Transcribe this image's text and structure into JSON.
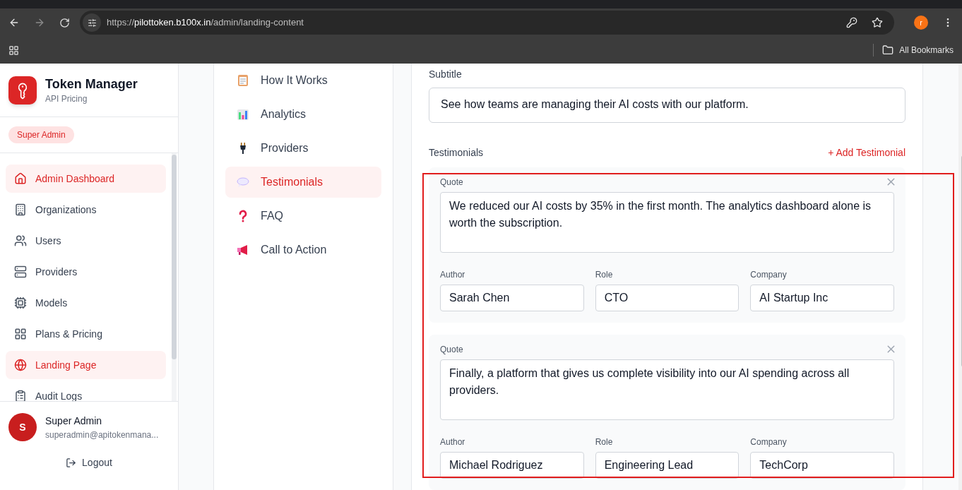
{
  "browser": {
    "url_scheme": "https://",
    "url_host": "pilottoken.b100x.in",
    "url_path": "/admin/landing-content",
    "profile_initial": "r",
    "bookmarks_label": "All Bookmarks"
  },
  "sidebar": {
    "brand_title": "Token Manager",
    "brand_subtitle": "API Pricing",
    "role_badge": "Super Admin",
    "items": [
      {
        "label": "Admin Dashboard",
        "selected": true
      },
      {
        "label": "Organizations",
        "selected": false
      },
      {
        "label": "Users",
        "selected": false
      },
      {
        "label": "Providers",
        "selected": false
      },
      {
        "label": "Models",
        "selected": false
      },
      {
        "label": "Plans & Pricing",
        "selected": false
      },
      {
        "label": "Landing Page",
        "selected": true
      },
      {
        "label": "Audit Logs",
        "selected": false
      }
    ],
    "user": {
      "initial": "S",
      "name": "Super Admin",
      "email": "superadmin@apitokenmana..."
    },
    "logout": "Logout"
  },
  "sections": [
    {
      "label": "How It Works",
      "selected": false
    },
    {
      "label": "Analytics",
      "selected": false
    },
    {
      "label": "Providers",
      "selected": false
    },
    {
      "label": "Testimonials",
      "selected": true
    },
    {
      "label": "FAQ",
      "selected": false
    },
    {
      "label": "Call to Action",
      "selected": false
    }
  ],
  "editor": {
    "subtitle_label": "Subtitle",
    "subtitle_value": "See how teams are managing their AI costs with our platform.",
    "testimonials_label": "Testimonials",
    "add_button": "+ Add Testimonial",
    "testimonials": [
      {
        "quote_label": "Quote",
        "quote": "We reduced our AI costs by 35% in the first month. The analytics dashboard alone is worth the subscription.",
        "author_label": "Author",
        "author": "Sarah Chen",
        "role_label": "Role",
        "role": "CTO",
        "company_label": "Company",
        "company": "AI Startup Inc"
      },
      {
        "quote_label": "Quote",
        "quote": "Finally, a platform that gives us complete visibility into our AI spending across all providers.",
        "author_label": "Author",
        "author": "Michael Rodriguez",
        "role_label": "Role",
        "role": "Engineering Lead",
        "company_label": "Company",
        "company": "TechCorp"
      }
    ]
  }
}
